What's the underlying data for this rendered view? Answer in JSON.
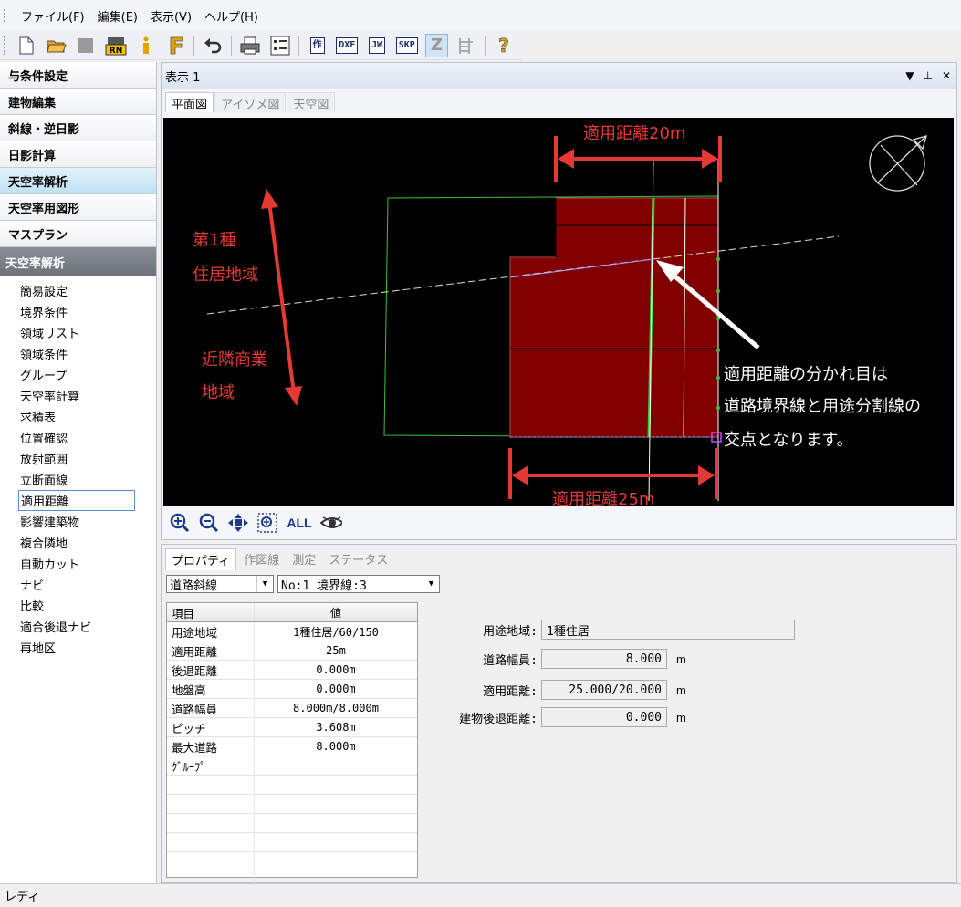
{
  "menu": [
    "ファイル(F)",
    "編集(E)",
    "表示(V)",
    "ヘルプ(H)"
  ],
  "toolbar": {
    "buttons": [
      "new-file",
      "open-folder",
      "stop",
      "rn",
      "info",
      "f",
      "undo",
      "print",
      "settings",
      "saku",
      "DXF",
      "JW",
      "SKP",
      "Z",
      "stairs",
      "help"
    ],
    "labels": {
      "saku": "作",
      "dxf": "DXF",
      "jw": "JW",
      "skp": "SKP",
      "z": "Z",
      "help": "?"
    }
  },
  "sidebar": {
    "categories": [
      "与条件設定",
      "建物編集",
      "斜線・逆日影",
      "日影計算",
      "天空率解析",
      "天空率用図形",
      "マスプラン"
    ],
    "selected_category": "天空率解析",
    "panel_title": "天空率解析",
    "items": [
      "簡易設定",
      "境界条件",
      "領域リスト",
      "領域条件",
      "グループ",
      "天空率計算",
      "求積表",
      "位置確認",
      "放射範囲",
      "立断面線",
      "適用距離",
      "影響建築物",
      "複合隣地",
      "自動カット",
      "ナビ",
      "比較",
      "適合後退ナビ",
      "再地区"
    ],
    "selected_item": "適用距離"
  },
  "view": {
    "title": "表示 1",
    "tabs": [
      "平面図",
      "アイソメ図",
      "天空図"
    ],
    "controls": [
      "▼",
      "⊥",
      "✕"
    ]
  },
  "canvas": {
    "dim_top": "適用距離20m",
    "dim_bottom": "適用距離25m",
    "zone1_line1": "第1種",
    "zone1_line2": "住居地域",
    "zone2_line1": "近隣商業",
    "zone2_line2": "地域",
    "note_line1": "適用距離の分かれ目は",
    "note_line2": "道路境界線と用途分割線の",
    "note_line3": "交点となります。",
    "colors": {
      "building": "#800000",
      "annotation": "#e53935",
      "site": "#22c55e"
    }
  },
  "zoombar": {
    "all_label": "ALL"
  },
  "props": {
    "tabs": [
      "プロパティ",
      "作図線",
      "測定",
      "ステータス"
    ],
    "select1": "道路斜線",
    "select2": "No:1 境界線:3",
    "grid_headers": [
      "項目",
      "値"
    ],
    "rows": [
      [
        "用途地域",
        "1種住居/60/150"
      ],
      [
        "適用距離",
        "25m"
      ],
      [
        "後退距離",
        "0.000m"
      ],
      [
        "地盤高",
        "0.000m"
      ],
      [
        "道路幅員",
        "8.000m/8.000m"
      ],
      [
        "ピッチ",
        "3.608m"
      ],
      [
        "最大道路",
        "8.000m"
      ],
      [
        "ｸﾞﾙｰﾌﾟ",
        ""
      ]
    ],
    "form": [
      {
        "label": "用途地域:",
        "value": "1種住居",
        "unit": ""
      },
      {
        "label": "道路幅員:",
        "value": "8.000",
        "unit": "m"
      },
      {
        "label": "適用距離:",
        "value": "25.000/20.000",
        "unit": "m"
      },
      {
        "label": "建物後退距離:",
        "value": "0.000",
        "unit": "m"
      }
    ]
  },
  "status": "レディ"
}
